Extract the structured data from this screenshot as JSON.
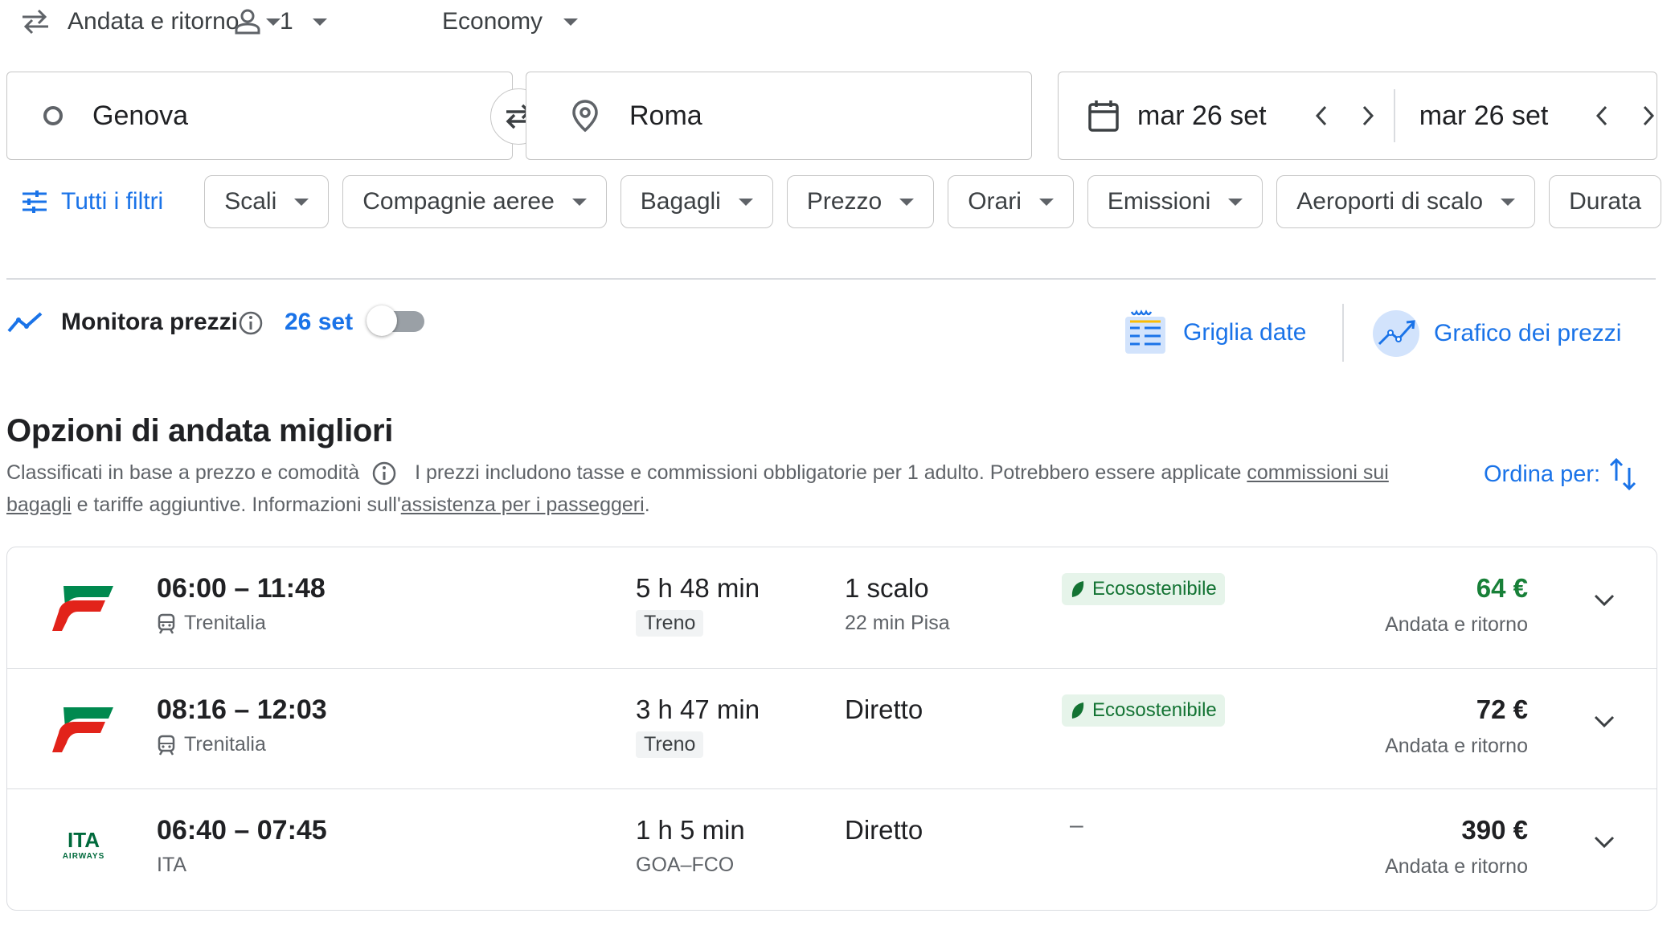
{
  "trip": {
    "type": "Andata e ritorno",
    "passengers": "1",
    "cabin": "Economy"
  },
  "search": {
    "origin": "Genova",
    "destination": "Roma",
    "depart_date": "mar 26 set",
    "return_date": "mar 26 set"
  },
  "filters": {
    "all_label": "Tutti i filtri",
    "chips": [
      "Scali",
      "Compagnie aeree",
      "Bagagli",
      "Prezzo",
      "Orari",
      "Emissioni",
      "Aeroporti di scalo",
      "Durata"
    ]
  },
  "tracking": {
    "label": "Monitora prezzi",
    "date": "26 set",
    "enabled": false
  },
  "tools": {
    "date_grid": "Griglia date",
    "price_graph": "Grafico dei prezzi"
  },
  "results": {
    "heading": "Opzioni di andata migliori",
    "ranked_by": "Classificati in base a prezzo e comodità",
    "disclaimer_a": "I prezzi includono tasse e commissioni obbligatorie per 1 adulto. Potrebbero essere applicate ",
    "disclaimer_link1": "commissioni sui bagagli",
    "disclaimer_b": " e tariffe aggiuntive. Informazioni sull'",
    "disclaimer_link2": "assistenza per i passeggeri",
    "disclaimer_c": ".",
    "sort_label": "Ordina per:",
    "items": [
      {
        "time": "06:00 – 11:48",
        "carrier": "Trenitalia",
        "duration": "5 h 48 min",
        "duration_sub": "Treno",
        "stops": "1 scalo",
        "stops_sub": "22 min Pisa",
        "eco": "Ecosostenibile",
        "price": "64 €",
        "price_sub": "Andata e ritorno"
      },
      {
        "time": "08:16 – 12:03",
        "carrier": "Trenitalia",
        "duration": "3 h 47 min",
        "duration_sub": "Treno",
        "stops": "Diretto",
        "stops_sub": "",
        "eco": "Ecosostenibile",
        "price": "72 €",
        "price_sub": "Andata e ritorno"
      },
      {
        "time": "06:40 – 07:45",
        "carrier": "ITA",
        "duration": "1 h 5 min",
        "duration_sub": "GOA–FCO",
        "stops": "Diretto",
        "stops_sub": "",
        "eco": "–",
        "price": "390 €",
        "price_sub": "Andata e ritorno"
      }
    ]
  },
  "logos": {
    "ita": "ITA",
    "ita_sub": "AIRWAYS"
  },
  "colors": {
    "accent": "#1a73e8",
    "eco_green": "#137333",
    "best_price": "#188038",
    "trenitalia_red": "#e2231a",
    "trenitalia_green": "#00894f"
  }
}
